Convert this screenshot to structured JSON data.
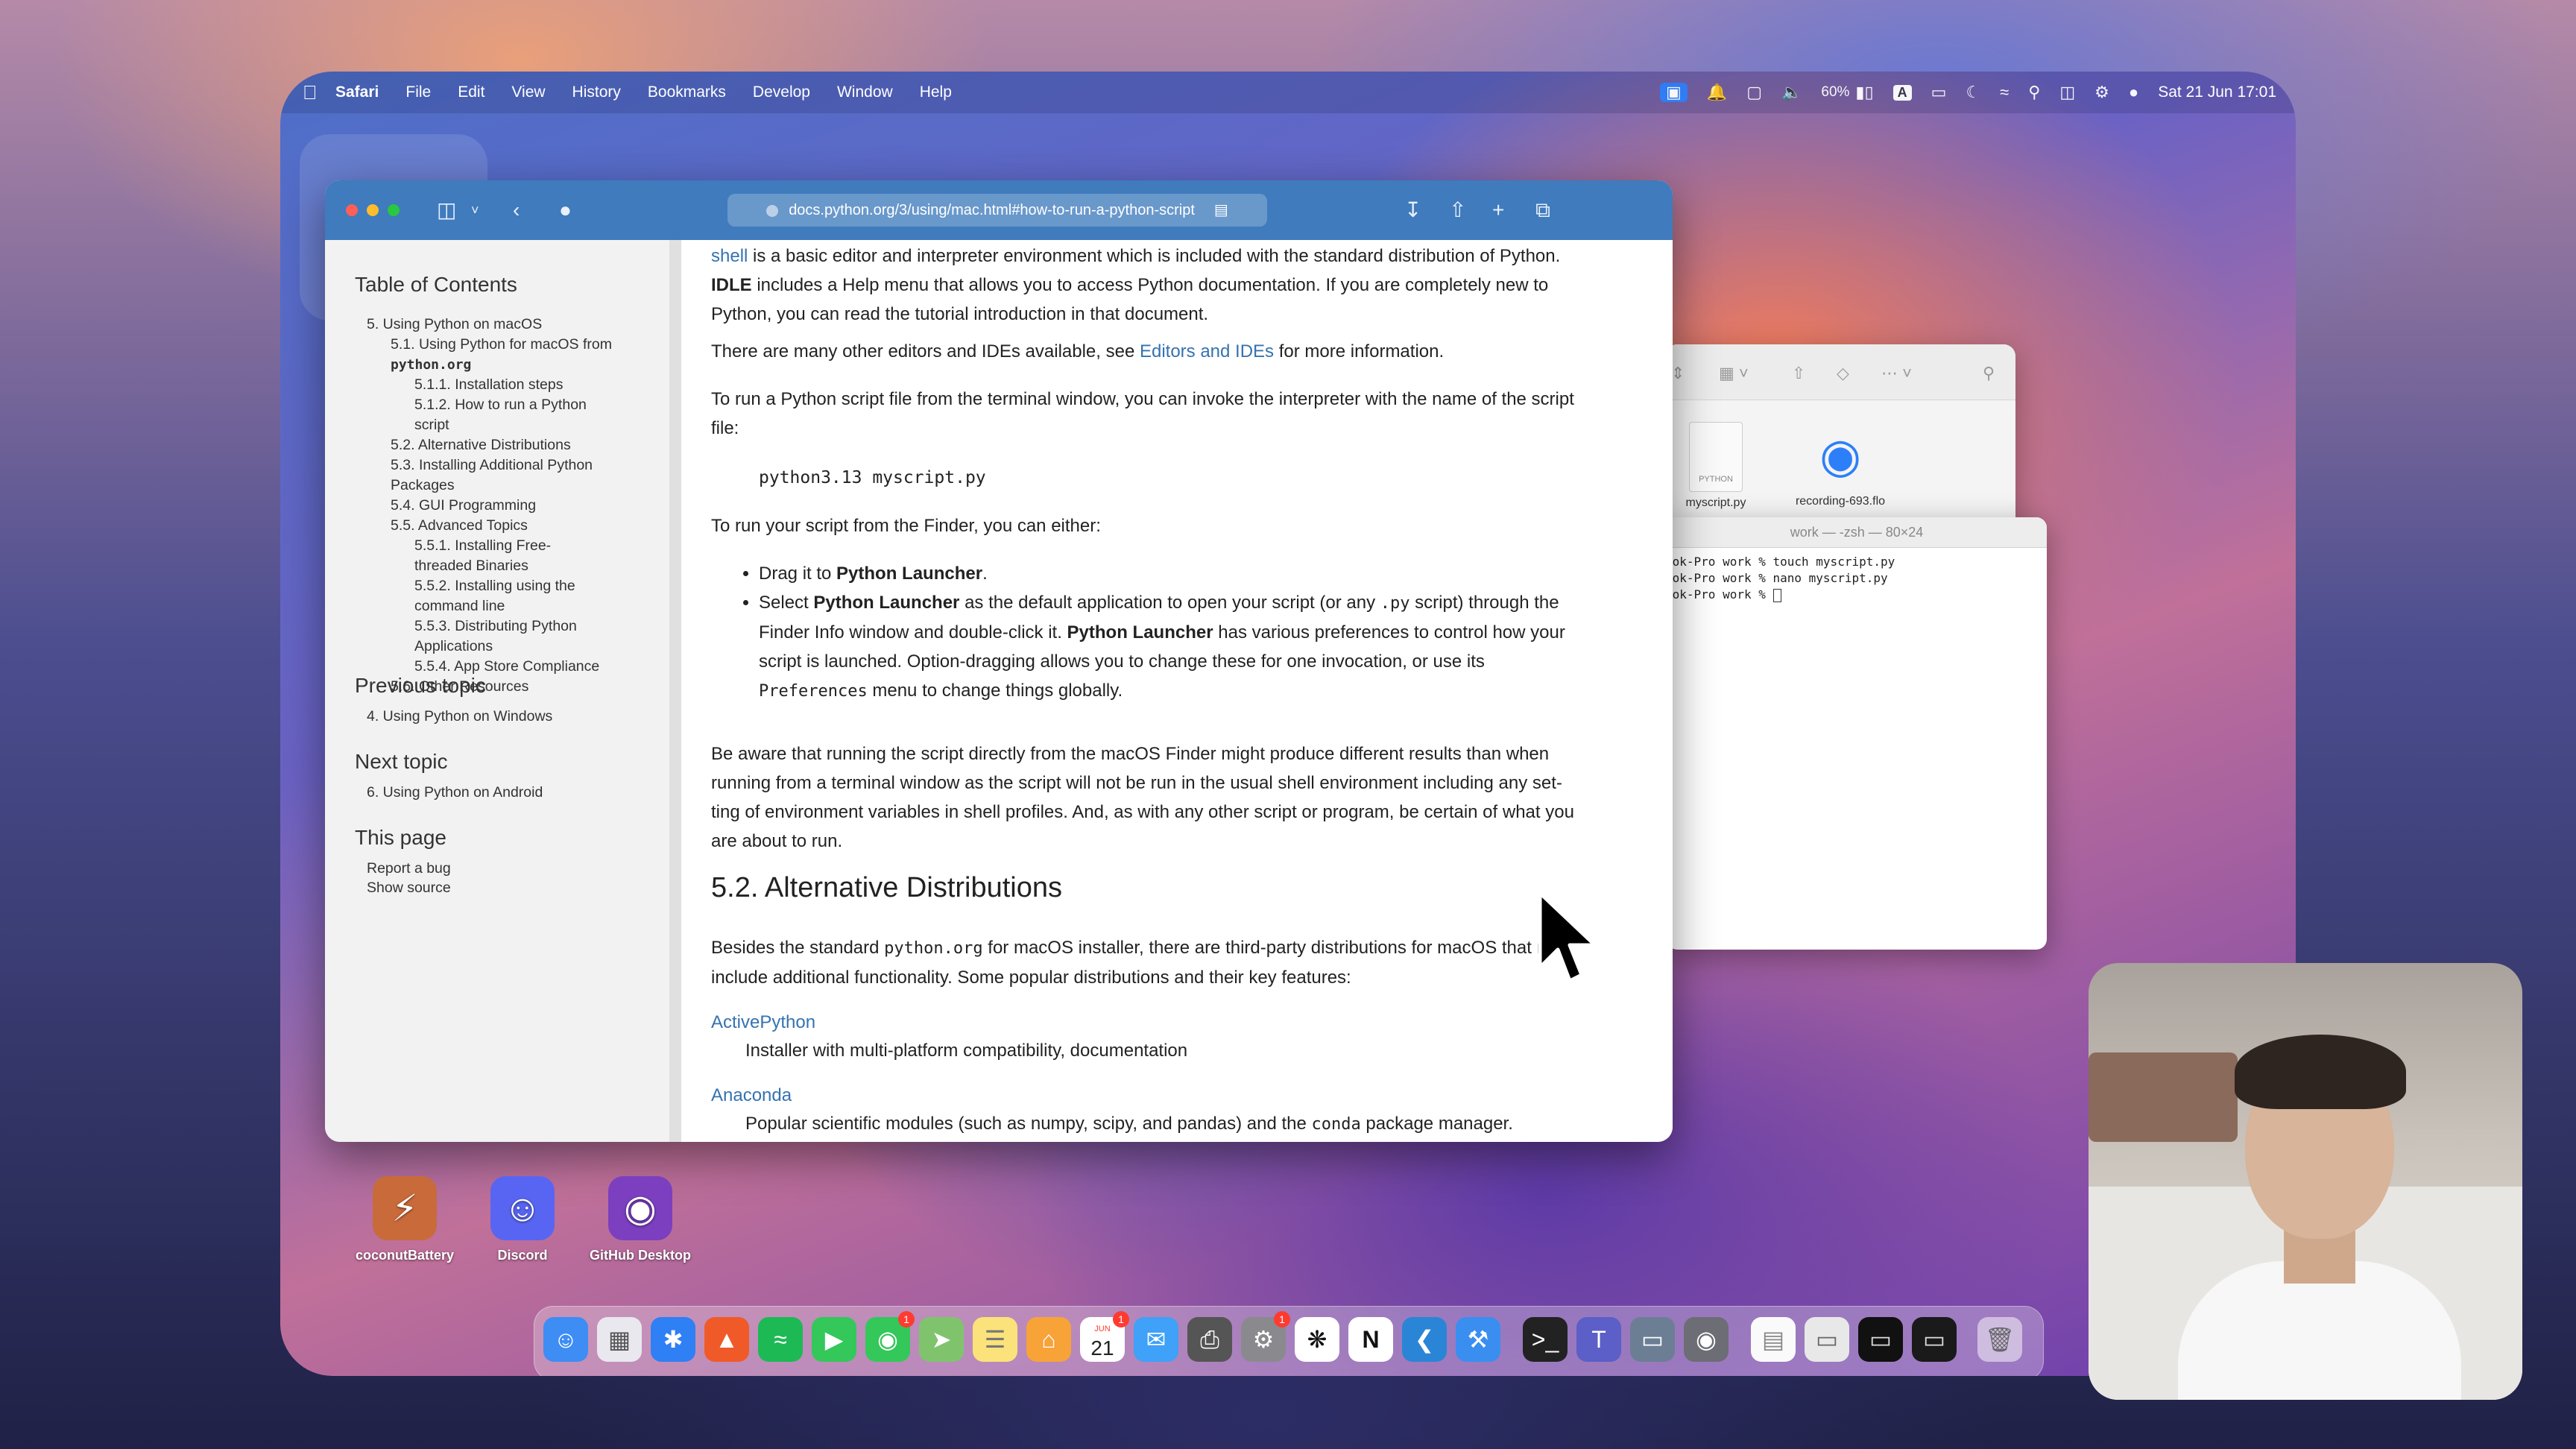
{
  "menubar": {
    "apple": "",
    "items": [
      "Safari",
      "File",
      "Edit",
      "View",
      "History",
      "Bookmarks",
      "Develop",
      "Window",
      "Help"
    ],
    "battery": "60%",
    "input_source": "A",
    "datetime": "Sat 21 Jun  17:01"
  },
  "safari": {
    "url": "docs.python.org/3/using/mac.html#how-to-run-a-python-script"
  },
  "sidebar": {
    "toc_title": "Table of Contents",
    "toc": [
      {
        "text": "5. Using Python on macOS",
        "level": 1
      },
      {
        "text": "5.1. Using Python for macOS from",
        "level": 2
      },
      {
        "text": "python.org",
        "level": 2,
        "code": true
      },
      {
        "text": "5.1.1. Installation steps",
        "level": 3
      },
      {
        "text": "5.1.2. How to run a Python",
        "level": 3
      },
      {
        "text": "script",
        "level": 3
      },
      {
        "text": "5.2. Alternative Distributions",
        "level": 2
      },
      {
        "text": "5.3. Installing Additional Python",
        "level": 2
      },
      {
        "text": "Packages",
        "level": 2
      },
      {
        "text": "5.4. GUI Programming",
        "level": 2
      },
      {
        "text": "5.5. Advanced Topics",
        "level": 2
      },
      {
        "text": "5.5.1. Installing Free-",
        "level": 3
      },
      {
        "text": "threaded Binaries",
        "level": 3
      },
      {
        "text": "5.5.2. Installing using the",
        "level": 3
      },
      {
        "text": "command line",
        "level": 3
      },
      {
        "text": "5.5.3. Distributing Python",
        "level": 3
      },
      {
        "text": "Applications",
        "level": 3
      },
      {
        "text": "5.5.4. App Store Compliance",
        "level": 3
      },
      {
        "text": "5.6. Other Resources",
        "level": 2
      }
    ],
    "previous_title": "Previous topic",
    "previous_link": "4. Using Python on Windows",
    "next_title": "Next topic",
    "next_link": "6. Using Python on Android",
    "this_page_title": "This page",
    "report_bug": "Report a bug",
    "show_source": "Show source"
  },
  "content": {
    "p1_link": "shell",
    "p1_a": " is a basic editor and interpreter environment which is included with the standard distribution of Python.",
    "p1_bold": "IDLE",
    "p1_b": " includes a Help menu that allows you to access Python documentation. If you are completely new to",
    "p1_c": "Python, you can read the tutorial introduction in that document.",
    "p2_a": "There are many other editors and IDEs available, see ",
    "p2_link": "Editors and IDEs",
    "p2_b": " for more information.",
    "p3_a": "To run a Python script file from the terminal window, you can invoke the interpreter with the name of the script",
    "p3_b": "file:",
    "code1": "python3.13 myscript.py",
    "p4": "To run your script from the Finder, you can either:",
    "li1_a": "Drag it to ",
    "li1_bold": "Python Launcher",
    "li1_b": ".",
    "li2_a": "Select ",
    "li2_bold1": "Python Launcher",
    "li2_b": " as the default application to open your script (or any ",
    "li2_code1": ".py",
    "li2_c": " script) through the",
    "li2_d": "Finder Info window and double-click it. ",
    "li2_bold2": "Python Launcher",
    "li2_e": " has various preferences to control how your",
    "li2_f": "script is launched. Option-dragging allows you to change these for one invocation, or use its",
    "li2_code2": "Preferences",
    "li2_g": " menu to change things globally.",
    "p5_a": "Be aware that running the script directly from the macOS Finder might produce different results than when",
    "p5_b": "running from a terminal window as the script will not be run in the usual shell environment including any set-",
    "p5_c": "ting of environment variables in shell profiles. And, as with any other script or program, be certain of what you",
    "p5_d": "are about to run.",
    "h2": "5.2. Alternative Distributions",
    "p6_a": "Besides the standard ",
    "p6_code": "python.org",
    "p6_b": " for macOS installer, there are third-party distributions for macOS that may",
    "p6_c": "include additional functionality. Some popular distributions and their key features:",
    "dt1": "ActivePython",
    "dd1": "Installer with multi-platform compatibility, documentation",
    "dt2": "Anaconda",
    "dd2_a": "Popular scientific modules (such as numpy, scipy, and pandas) and the ",
    "dd2_code": "conda",
    "dd2_b": " package manager."
  },
  "finder": {
    "file1_badge": "PYTHON",
    "file1_name": "myscript.py",
    "file2_name": "recording-693.flo"
  },
  "terminal": {
    "title": "work — -zsh — 80×24",
    "line1": "ook-Pro work % touch myscript.py",
    "line2": "ook-Pro work % nano myscript.py",
    "line3": "ook-Pro work % "
  },
  "desktop_icons": [
    {
      "label": "coconutBattery",
      "color": "#c96a3a"
    },
    {
      "label": "Discord",
      "color": "#5865f2"
    },
    {
      "label": "GitHub Desktop",
      "color": "#7b3fbf"
    }
  ],
  "dock": {
    "calendar_month": "JUN",
    "calendar_day": "21"
  }
}
